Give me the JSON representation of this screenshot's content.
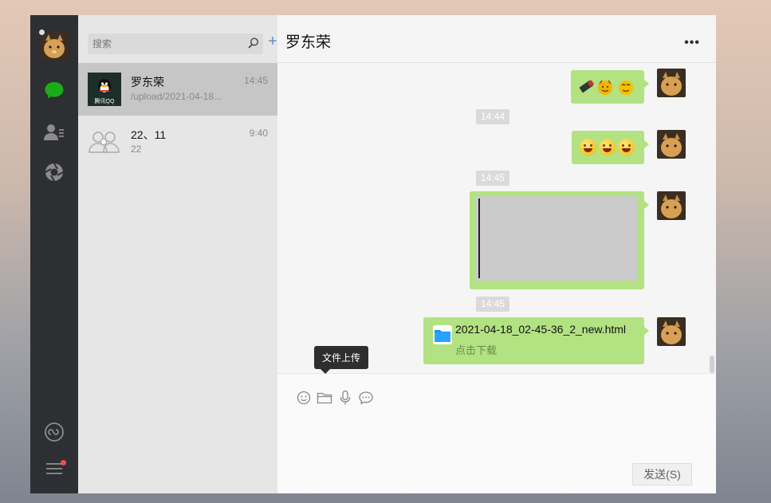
{
  "sidebar": {
    "nav_icons": [
      "chat-icon",
      "contacts-icon",
      "moments-icon",
      "mini-program-icon",
      "menu-icon"
    ],
    "accent": "#1aad19"
  },
  "search": {
    "placeholder": "搜索"
  },
  "sessions": [
    {
      "name": "罗东荣",
      "time": "14:45",
      "preview": "/upload/2021-04-18...",
      "avatar": "qq-logo",
      "avatar_caption": "腾讯QQ",
      "active": true
    },
    {
      "name": "22、11",
      "time": "9:40",
      "preview": "22",
      "avatar": "group-avatar",
      "active": false
    }
  ],
  "chat": {
    "title": "罗东荣",
    "more_label": "•••",
    "messages": [
      {
        "kind": "emoji",
        "content": "emoji-row-1"
      },
      {
        "kind": "time",
        "text": "14:44"
      },
      {
        "kind": "emoji",
        "content": "emoji-row-2"
      },
      {
        "kind": "time",
        "text": "14:45"
      },
      {
        "kind": "image",
        "content": "image-placeholder"
      },
      {
        "kind": "time",
        "text": "14:45"
      },
      {
        "kind": "file",
        "file_name": "2021-04-18_02-45-36_2_new.html",
        "action": "点击下载"
      }
    ]
  },
  "composer": {
    "tools": [
      "emoji-icon",
      "folder-icon",
      "microphone-icon",
      "chat-bubble-icon"
    ],
    "tooltip": "文件上传",
    "send_label": "发送(S)"
  },
  "colors": {
    "bubble": "#b2e281",
    "rail": "#2e2f32",
    "list": "#e6e6e6"
  }
}
